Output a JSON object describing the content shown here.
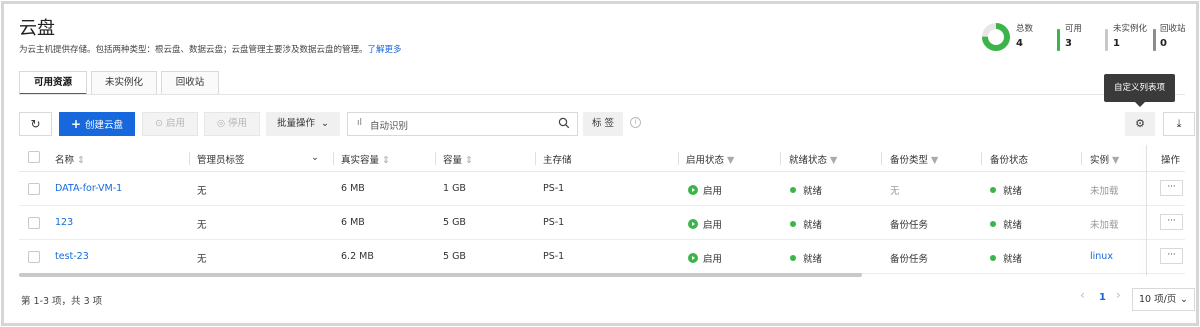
{
  "page": {
    "title": "云盘",
    "description": "为云主机提供存储。包括两种类型：根云盘、数据云盘；云盘管理主要涉及数据云盘的管理。",
    "learn_more": "了解更多"
  },
  "stats": {
    "total": {
      "label": "总数",
      "value": "4"
    },
    "available": {
      "label": "可用",
      "value": "3",
      "color": "#3bb54a"
    },
    "not_instantiated": {
      "label": "未实例化",
      "value": "1",
      "color": "#c8c8c8"
    },
    "recycle": {
      "label": "回收站",
      "value": "0",
      "color": "#8c8c8c"
    },
    "donut": {
      "available_fraction": 0.75,
      "color": "#3bb54a",
      "rest_color": "#e6e6e6"
    }
  },
  "tabs": [
    "可用资源",
    "未实例化",
    "回收站"
  ],
  "tooltip": "自定义列表项",
  "toolbar": {
    "refresh_icon": "refresh-icon",
    "create": "创建云盘",
    "enable": "启用",
    "disable": "停用",
    "batch": "批量操作",
    "search_placeholder": "自动识别",
    "tags": "标 签"
  },
  "table": {
    "headers": [
      "名称",
      "管理员标签",
      "真实容量",
      "容量",
      "主存储",
      "启用状态",
      "就绪状态",
      "备份类型",
      "备份状态",
      "实例",
      "操作"
    ],
    "rows": [
      {
        "name": "DATA-for-VM-1",
        "admin_tag": "无",
        "real_size": "6 MB",
        "size": "1 GB",
        "storage": "PS-1",
        "enable_state": "启用",
        "ready_state": "就绪",
        "backup_type": "无",
        "backup_state": "就绪",
        "instance": "未加载",
        "op": "···"
      },
      {
        "name": "123",
        "admin_tag": "无",
        "real_size": "6 MB",
        "size": "5 GB",
        "storage": "PS-1",
        "enable_state": "启用",
        "ready_state": "就绪",
        "backup_type": "备份任务",
        "backup_state": "就绪",
        "instance": "未加载",
        "op": "···"
      },
      {
        "name": "test-23",
        "admin_tag": "无",
        "real_size": "6.2 MB",
        "size": "5 GB",
        "storage": "PS-1",
        "enable_state": "启用",
        "ready_state": "就绪",
        "backup_type": "备份任务",
        "backup_state": "就绪",
        "instance": "linux",
        "op": "···"
      }
    ]
  },
  "footer": {
    "summary": "第 1-3 项，共 3 项",
    "prev": "‹",
    "page": "1",
    "next": "›",
    "page_size": "10 项/页"
  }
}
